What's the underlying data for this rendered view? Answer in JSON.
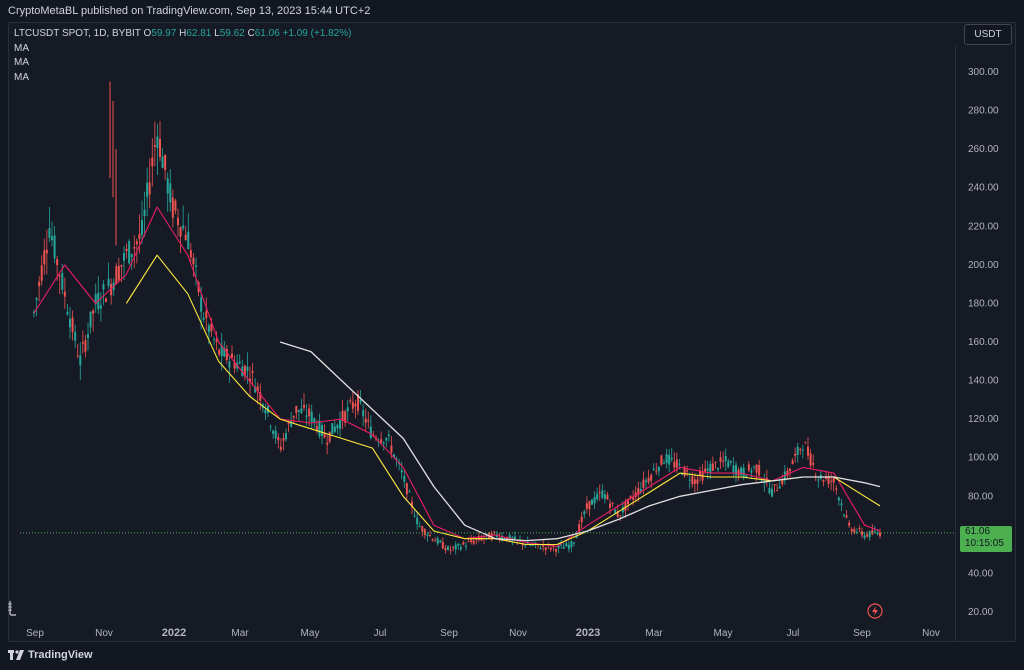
{
  "header": {
    "publisher_line": "CryptoMetaBL published on TradingView.com, Sep 13, 2023 15:44 UTC+2"
  },
  "legend": {
    "symbol": "LTCUSDT SPOT, 1D, BYBIT",
    "open_label": "O",
    "open": "59.97",
    "high_label": "H",
    "high": "62.81",
    "low_label": "L",
    "low": "59.62",
    "close_label": "C",
    "close": "61.06",
    "change": "+1.09 (+1.82%)",
    "indicators": [
      "MA",
      "MA",
      "MA"
    ]
  },
  "currency_button": "USDT",
  "price_badge": {
    "price": "61.06",
    "countdown": "10:15:05"
  },
  "footer": {
    "brand": "TradingView"
  },
  "icons": {
    "ruler": "ruler-icon",
    "replay": "flash-icon",
    "logo": "tradingview-logo-icon"
  },
  "colors": {
    "background": "#131722",
    "up": "#26a69a",
    "down": "#ef5350",
    "ma_fast": "#e91e63",
    "ma_mid": "#ffeb3b",
    "ma_slow": "#e0e0e0",
    "price_badge": "#4caf50"
  },
  "chart_data": {
    "type": "candlestick",
    "title": "LTCUSDT SPOT, 1D, BYBIT",
    "xlabel": "",
    "ylabel": "",
    "ylim": [
      10,
      315
    ],
    "y_ticks": [
      "300.00",
      "280.00",
      "260.00",
      "240.00",
      "220.00",
      "200.00",
      "180.00",
      "160.00",
      "140.00",
      "120.00",
      "100.00",
      "80.00",
      "60.00",
      "40.00",
      "20.00"
    ],
    "x_ticks": [
      "Sep",
      "Nov",
      "2022",
      "Mar",
      "May",
      "Jul",
      "Sep",
      "Nov",
      "2023",
      "Mar",
      "May",
      "Jul",
      "Sep",
      "Nov"
    ],
    "grid": false,
    "price_approx": [
      [
        0,
        175
      ],
      [
        3,
        220
      ],
      [
        6,
        185
      ],
      [
        9,
        150
      ],
      [
        12,
        180
      ],
      [
        15,
        190
      ],
      [
        18,
        205
      ],
      [
        21,
        215
      ],
      [
        24,
        270
      ],
      [
        27,
        230
      ],
      [
        30,
        215
      ],
      [
        33,
        175
      ],
      [
        36,
        155
      ],
      [
        39,
        150
      ],
      [
        42,
        145
      ],
      [
        45,
        128
      ],
      [
        48,
        105
      ],
      [
        51,
        125
      ],
      [
        54,
        122
      ],
      [
        57,
        110
      ],
      [
        60,
        120
      ],
      [
        63,
        130
      ],
      [
        66,
        112
      ],
      [
        69,
        110
      ],
      [
        72,
        90
      ],
      [
        75,
        65
      ],
      [
        78,
        58
      ],
      [
        81,
        52
      ],
      [
        84,
        55
      ],
      [
        87,
        58
      ],
      [
        90,
        60
      ],
      [
        93,
        58
      ],
      [
        96,
        55
      ],
      [
        99,
        54
      ],
      [
        102,
        53
      ],
      [
        105,
        55
      ],
      [
        108,
        75
      ],
      [
        111,
        82
      ],
      [
        114,
        70
      ],
      [
        117,
        80
      ],
      [
        120,
        90
      ],
      [
        123,
        100
      ],
      [
        126,
        95
      ],
      [
        129,
        88
      ],
      [
        132,
        95
      ],
      [
        135,
        98
      ],
      [
        138,
        92
      ],
      [
        141,
        95
      ],
      [
        144,
        82
      ],
      [
        147,
        92
      ],
      [
        150,
        108
      ],
      [
        153,
        90
      ],
      [
        156,
        88
      ],
      [
        159,
        64
      ],
      [
        162,
        60
      ],
      [
        165,
        61
      ]
    ],
    "series": [
      {
        "name": "MA",
        "values": [
          [
            0,
            175
          ],
          [
            6,
            200
          ],
          [
            12,
            180
          ],
          [
            18,
            195
          ],
          [
            24,
            230
          ],
          [
            30,
            205
          ],
          [
            36,
            160
          ],
          [
            42,
            140
          ],
          [
            48,
            120
          ],
          [
            54,
            118
          ],
          [
            60,
            120
          ],
          [
            66,
            112
          ],
          [
            72,
            95
          ],
          [
            78,
            65
          ],
          [
            84,
            58
          ],
          [
            90,
            60
          ],
          [
            96,
            56
          ],
          [
            102,
            54
          ],
          [
            108,
            65
          ],
          [
            114,
            75
          ],
          [
            120,
            85
          ],
          [
            126,
            95
          ],
          [
            132,
            92
          ],
          [
            138,
            92
          ],
          [
            144,
            88
          ],
          [
            150,
            95
          ],
          [
            156,
            92
          ],
          [
            162,
            65
          ],
          [
            165,
            62
          ]
        ]
      },
      {
        "name": "MA",
        "values": [
          [
            18,
            180
          ],
          [
            24,
            205
          ],
          [
            30,
            185
          ],
          [
            36,
            150
          ],
          [
            42,
            132
          ],
          [
            48,
            120
          ],
          [
            54,
            115
          ],
          [
            60,
            110
          ],
          [
            66,
            105
          ],
          [
            72,
            80
          ],
          [
            78,
            62
          ],
          [
            84,
            58
          ],
          [
            90,
            58
          ],
          [
            96,
            55
          ],
          [
            102,
            55
          ],
          [
            108,
            62
          ],
          [
            114,
            72
          ],
          [
            120,
            82
          ],
          [
            126,
            92
          ],
          [
            132,
            90
          ],
          [
            138,
            90
          ],
          [
            144,
            88
          ],
          [
            150,
            90
          ],
          [
            156,
            90
          ],
          [
            162,
            80
          ],
          [
            165,
            75
          ]
        ]
      },
      {
        "name": "MA",
        "values": [
          [
            48,
            160
          ],
          [
            54,
            155
          ],
          [
            60,
            140
          ],
          [
            66,
            125
          ],
          [
            72,
            110
          ],
          [
            78,
            85
          ],
          [
            84,
            65
          ],
          [
            90,
            58
          ],
          [
            96,
            57
          ],
          [
            102,
            58
          ],
          [
            108,
            62
          ],
          [
            114,
            68
          ],
          [
            120,
            75
          ],
          [
            126,
            80
          ],
          [
            132,
            83
          ],
          [
            138,
            86
          ],
          [
            144,
            88
          ],
          [
            150,
            90
          ],
          [
            156,
            90
          ],
          [
            162,
            87
          ],
          [
            165,
            85
          ]
        ]
      }
    ]
  }
}
